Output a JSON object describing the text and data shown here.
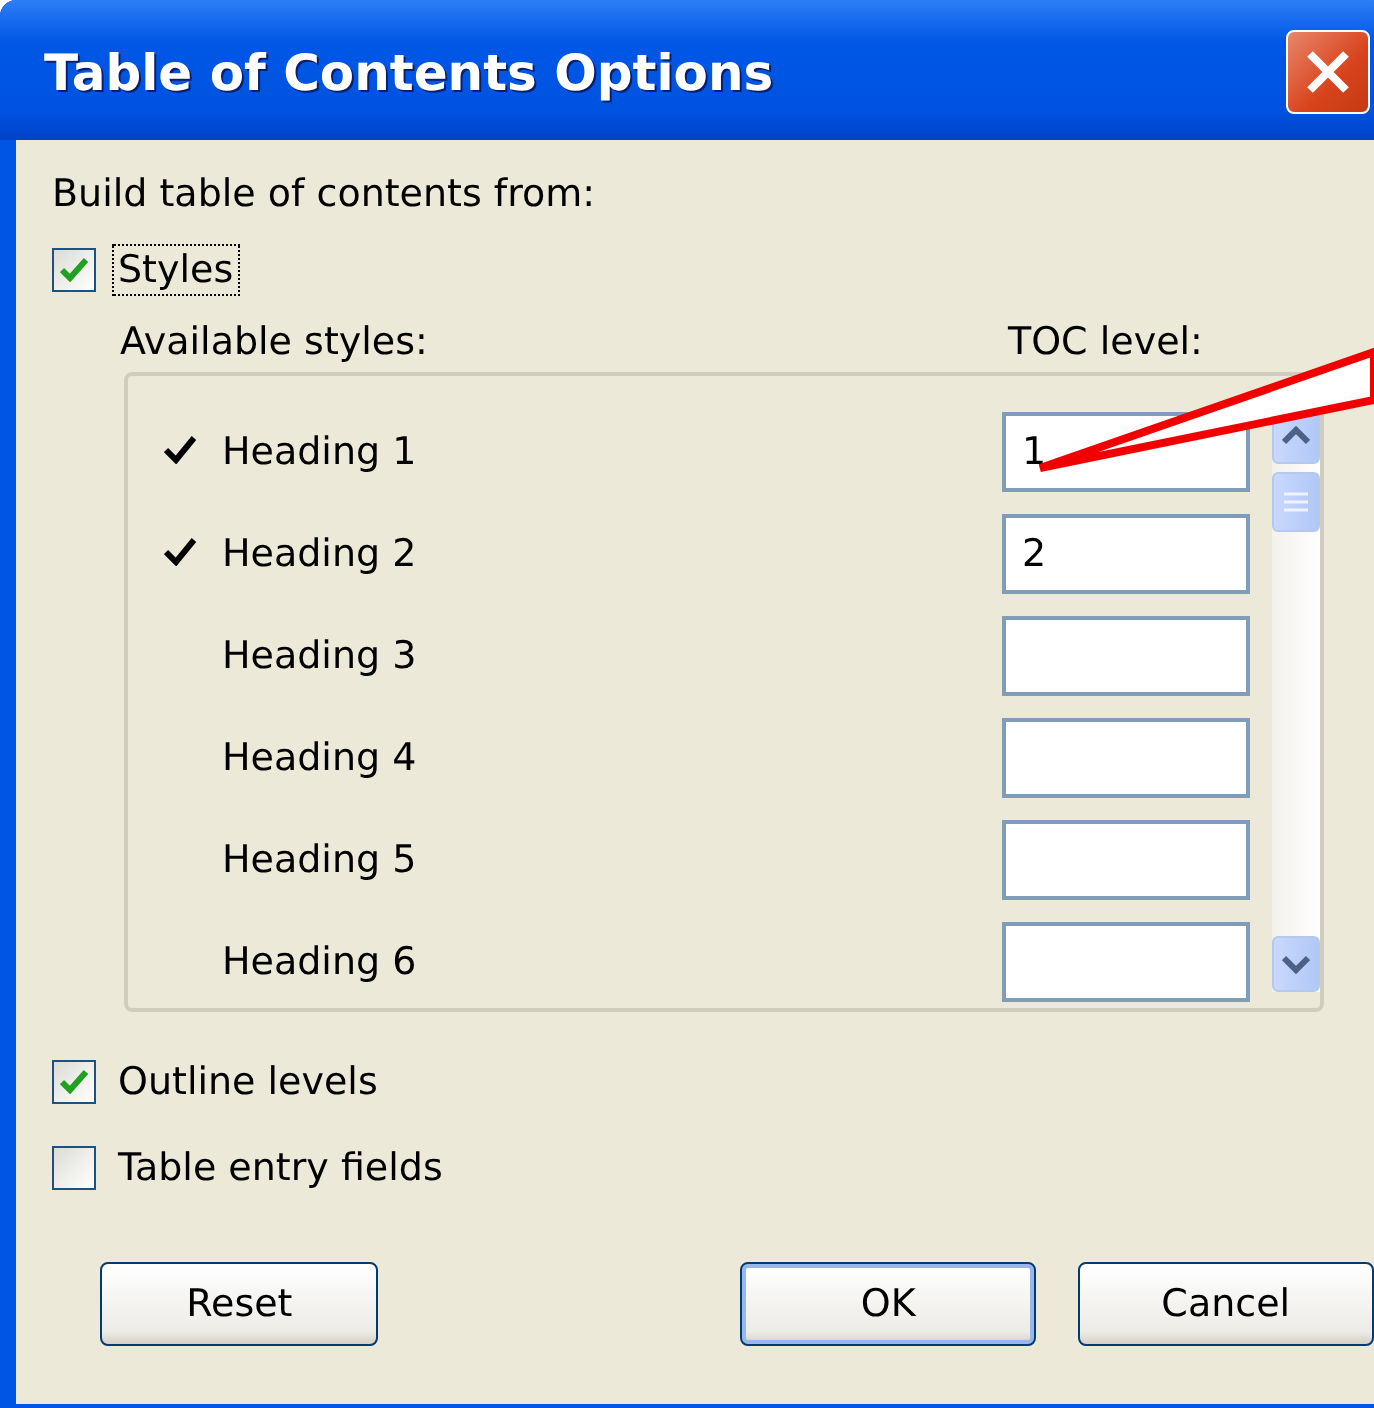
{
  "window": {
    "title": "Table of Contents Options"
  },
  "build_label": "Build table of contents from:",
  "styles_option": {
    "label": "Styles",
    "checked": true,
    "focused": true
  },
  "columns": {
    "available": "Available styles:",
    "level": "TOC level:"
  },
  "styles": [
    {
      "name": "Heading 1",
      "in_use": true,
      "level": "1"
    },
    {
      "name": "Heading 2",
      "in_use": true,
      "level": "2"
    },
    {
      "name": "Heading 3",
      "in_use": false
    },
    {
      "name": "Heading 4",
      "in_use": false
    },
    {
      "name": "Heading 5",
      "in_use": false
    },
    {
      "name": "Heading 6",
      "in_use": false
    }
  ],
  "options": [
    {
      "label": "Outline levels",
      "checked": true
    },
    {
      "label": "Table entry fields",
      "checked": false
    }
  ],
  "buttons": [
    {
      "label": "Reset",
      "default": false
    },
    {
      "label": "OK",
      "default": true
    },
    {
      "label": "Cancel",
      "default": false
    }
  ]
}
